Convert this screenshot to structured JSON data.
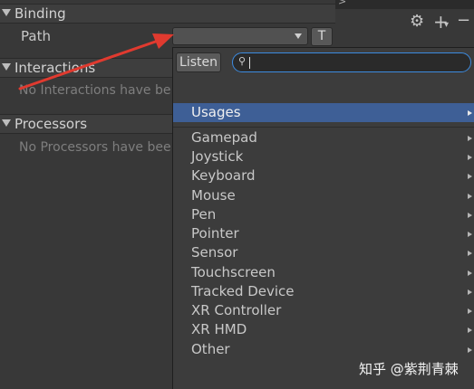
{
  "inspector": {
    "binding_title": "Binding",
    "path_label": "Path",
    "interactions_title": "Interactions",
    "interactions_empty": "No Interactions have be",
    "processors_title": "Processors",
    "processors_empty": "No Processors have bee"
  },
  "top_strip": {
    "chevron": ">"
  },
  "toolbar": {
    "gear_icon": "⚙",
    "add_icon": "+",
    "add_dropdown_icon": "▾",
    "remove_icon": "−"
  },
  "path_field": {
    "t_label": "T"
  },
  "popup": {
    "listen_label": "Listen",
    "search_icon": "⚲",
    "search_value": "",
    "usages_label": "Usages",
    "devices": [
      "Gamepad",
      "Joystick",
      "Keyboard",
      "Mouse",
      "Pen",
      "Pointer",
      "Sensor",
      "Touchscreen",
      "Tracked Device",
      "XR Controller",
      "XR HMD",
      "Other"
    ]
  },
  "watermark": "知乎 @紫荆青棘",
  "colors": {
    "selection": "#3e5f96",
    "search_focus": "#3c8be0",
    "annotation": "#e03a2f"
  }
}
